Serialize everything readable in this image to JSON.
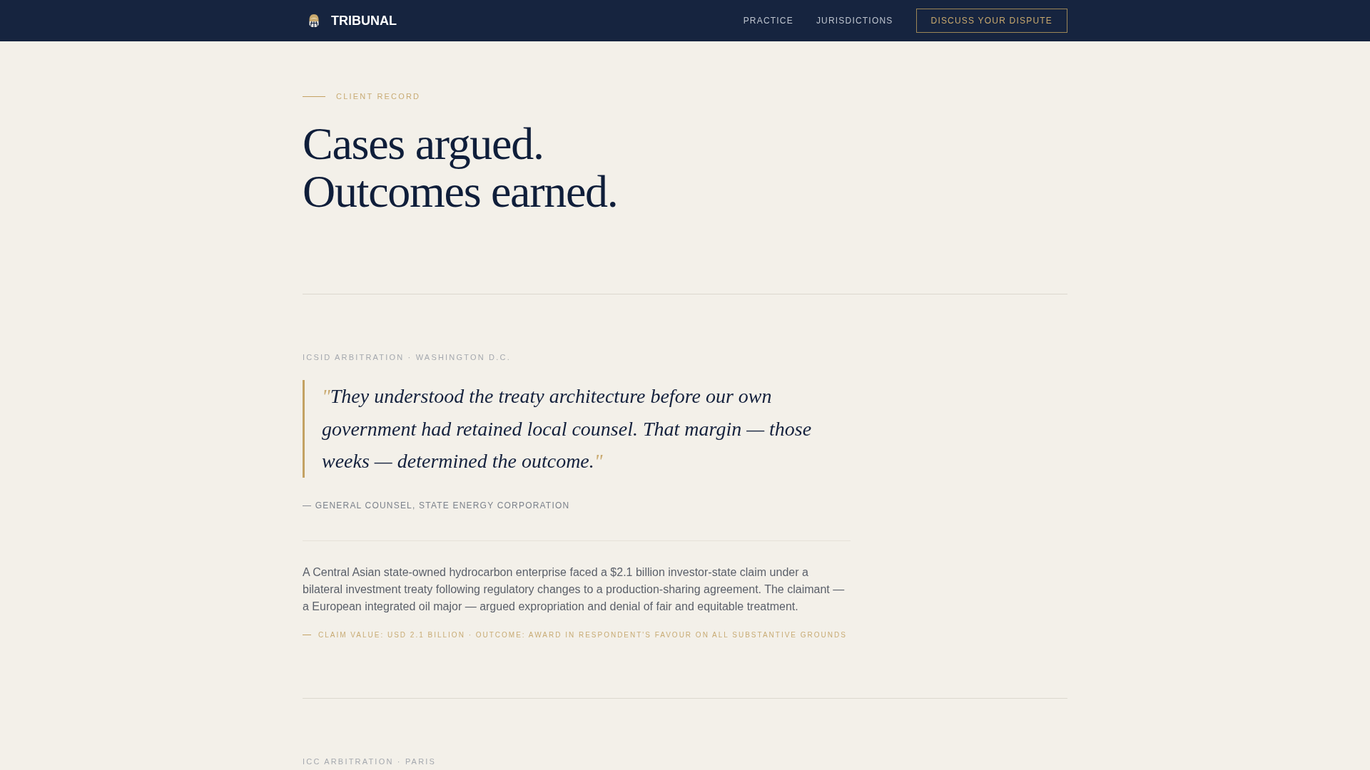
{
  "nav": {
    "brand": "TRIBUNAL",
    "links": [
      {
        "label": "PRACTICE"
      },
      {
        "label": "JURISDICTIONS"
      }
    ],
    "cta": "DISCUSS YOUR DISPUTE"
  },
  "hero": {
    "eyebrow": "CLIENT RECORD",
    "title_lines": [
      "Cases argued.",
      "Outcomes earned."
    ]
  },
  "cases": [
    {
      "venue": "ICSID ARBITRATION · WASHINGTON D.C.",
      "open_mark": "\"",
      "quote": "They understood the treaty architecture before our own government had retained local counsel. That margin — those weeks — determined the outcome.",
      "close_mark": "\"",
      "attribution": "— GENERAL COUNSEL, STATE ENERGY CORPORATION",
      "summary": "A Central Asian state-owned hydrocarbon enterprise faced a $2.1 billion investor-state claim under a bilateral investment treaty following regulatory changes to a production-sharing agreement. The claimant — a European integrated oil major — argued expropriation and denial of fair and equitable treatment.",
      "meta": "CLAIM VALUE: USD 2.1 BILLION · OUTCOME: AWARD IN RESPONDENT'S FAVOUR ON ALL SUBSTANTIVE GROUNDS"
    },
    {
      "venue": "ICC ARBITRATION · PARIS"
    }
  ]
}
